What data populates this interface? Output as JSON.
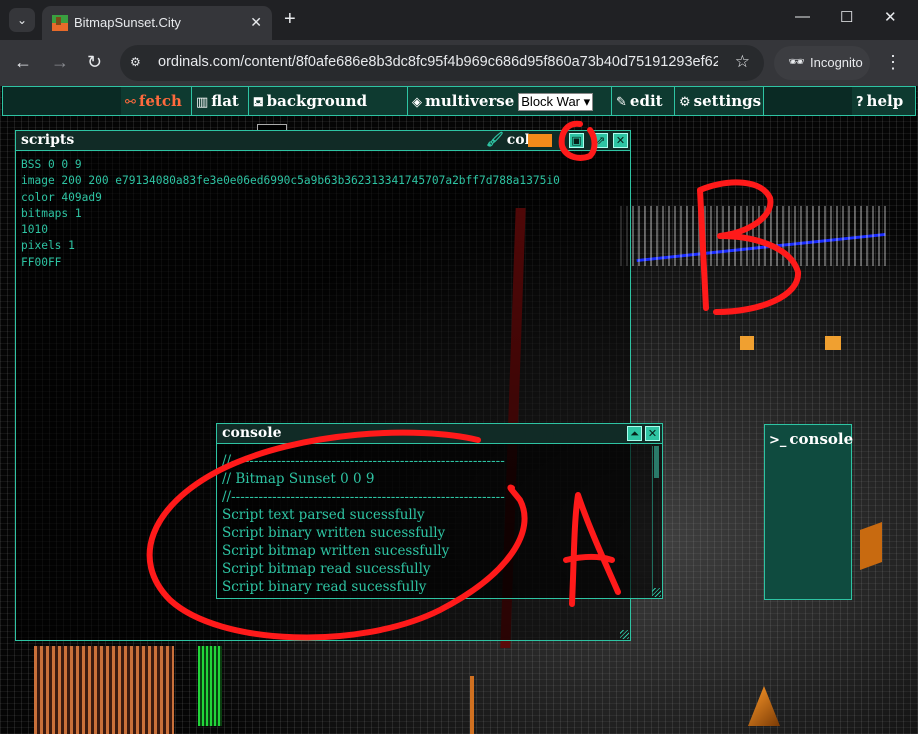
{
  "browser": {
    "tab_title": "BitmapSunset.City",
    "url": "ordinals.com/content/8f0afe686e8b3dc8fc95f4b969c686d95f860a73b40d75191293ef62b...",
    "incognito_label": "Incognito"
  },
  "menu": {
    "fetch": "fetch",
    "flat": "flat",
    "background": "background",
    "multiverse": "multiverse",
    "multiverse_selected": "Block War",
    "edit": "edit",
    "settings": "settings",
    "console": "console",
    "help": "help"
  },
  "scripts_panel": {
    "title": "scripts",
    "color_label": "color",
    "color_value": "#f58a1a",
    "code": "BSS 0 0 9\nimage 200 200 e79134080a83fe3e0e06ed6990c5a9b63b362313341745707a2bff7d788a1375i0\ncolor 409ad9\nbitmaps 1\n1010\npixels 1\nFF00FF"
  },
  "console_panel": {
    "title": "console",
    "lines": {
      "sep_top": "//------------------------------------------------------------",
      "header": "// Bitmap Sunset 0 0 9",
      "sep_bottom": "//------------------------------------------------------------",
      "l1": "Script text parsed sucessfully",
      "l2": "Script binary written sucessfully",
      "l3": "Script bitmap written sucessfully",
      "l4": "Script bitmap read sucessfully",
      "l5": "Script binary read sucessfully"
    }
  },
  "annotations": {
    "label_a": "A",
    "label_b": "B",
    "label_c": "C",
    "stroke_color": "#ff0000"
  }
}
